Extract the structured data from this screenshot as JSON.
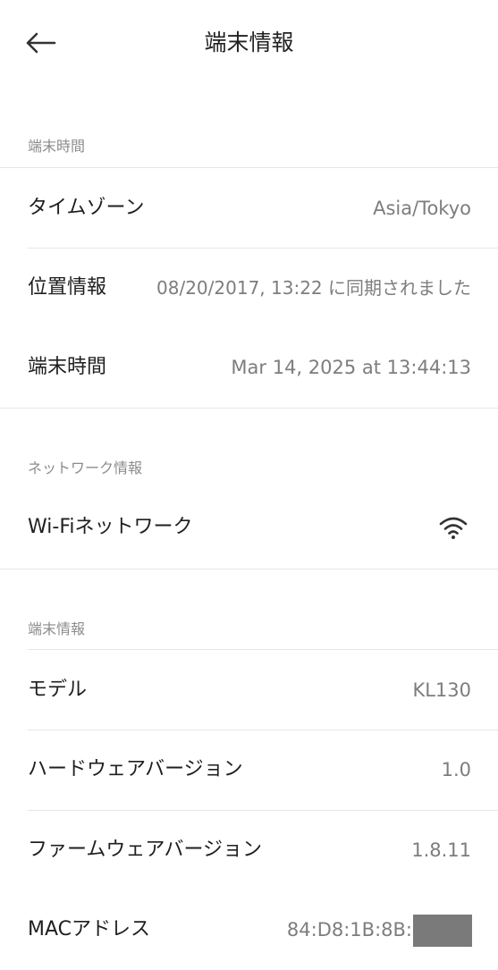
{
  "header": {
    "title": "端末情報",
    "back_icon": "arrow-left-icon"
  },
  "sections": {
    "device_time": {
      "title": "端末時間",
      "rows": [
        {
          "label": "タイムゾーン",
          "value": "Asia/Tokyo"
        },
        {
          "label": "位置情報",
          "value": "08/20/2017, 13:22 に同期されました"
        },
        {
          "label": "端末時間",
          "value": "Mar 14, 2025 at 13:44:13"
        }
      ]
    },
    "network": {
      "title": "ネットワーク情報",
      "rows": [
        {
          "label": "Wi-Fiネットワーク",
          "icon": "wifi-icon"
        }
      ]
    },
    "device_info": {
      "title": "端末情報",
      "rows": [
        {
          "label": "モデル",
          "value": "KL130"
        },
        {
          "label": "ハードウェアバージョン",
          "value": "1.0"
        },
        {
          "label": "ファームウェアバージョン",
          "value": "1.8.11"
        },
        {
          "label": "MACアドレス",
          "value": "84:D8:1B:8B:"
        }
      ]
    }
  },
  "colors": {
    "background": "#ffffff",
    "text_primary": "#1f1f1f",
    "text_secondary": "#7d7d7d",
    "section_title": "#8c8c8c",
    "divider": "#e6e6e6",
    "redaction": "#7a7a7a"
  }
}
